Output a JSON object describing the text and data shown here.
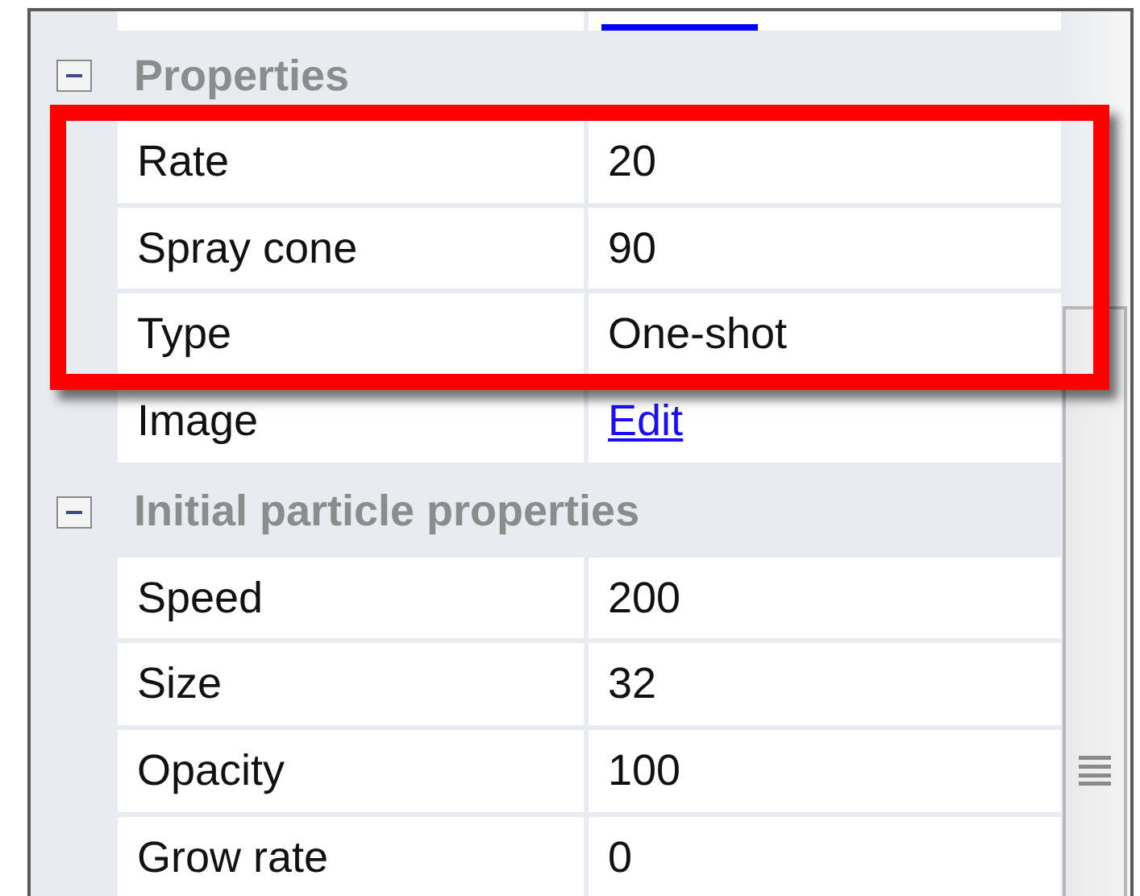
{
  "sections": [
    {
      "title": "Properties",
      "expanded": true,
      "rows": [
        {
          "label": "Rate",
          "value": "20",
          "kind": "text",
          "highlighted": true
        },
        {
          "label": "Spray cone",
          "value": "90",
          "kind": "text",
          "highlighted": true
        },
        {
          "label": "Type",
          "value": "One-shot",
          "kind": "text",
          "highlighted": true
        },
        {
          "label": "Image",
          "value": "Edit",
          "kind": "link",
          "highlighted": false
        }
      ]
    },
    {
      "title": "Initial particle properties",
      "expanded": true,
      "rows": [
        {
          "label": "Speed",
          "value": "200",
          "kind": "text",
          "highlighted": false
        },
        {
          "label": "Size",
          "value": "32",
          "kind": "text",
          "highlighted": false
        },
        {
          "label": "Opacity",
          "value": "100",
          "kind": "text",
          "highlighted": false
        },
        {
          "label": "Grow rate",
          "value": "0",
          "kind": "text",
          "highlighted": false
        }
      ]
    }
  ]
}
